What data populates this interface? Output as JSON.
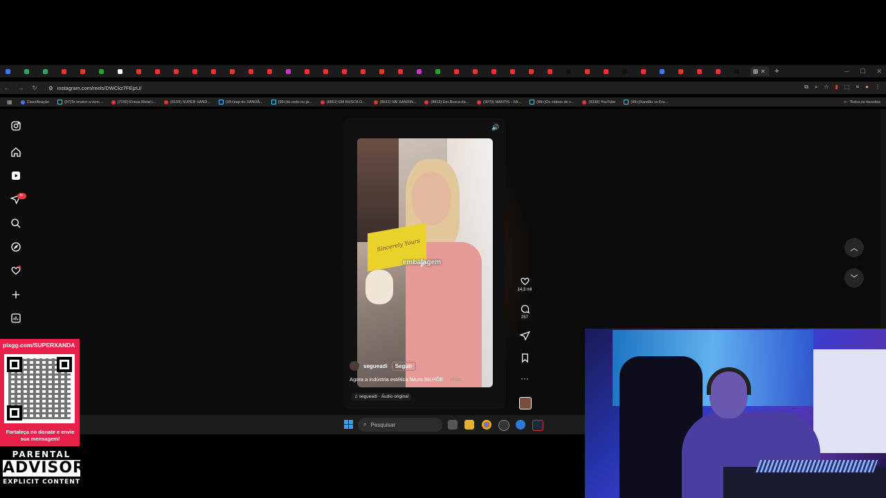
{
  "browser": {
    "url": "instagram.com/reels/DWCkz7FEjzU/",
    "bookmarks": [
      {
        "label": "Classificação",
        "icon": "globe-icon"
      },
      {
        "label": "(97)Te ensino a venc...",
        "icon": "tiktok-icon"
      },
      {
        "label": "(7292) Eneas Metal |...",
        "icon": "youtube-icon"
      },
      {
        "label": "(8159) SUPER XAND...",
        "icon": "youtube-icon"
      },
      {
        "label": "(99+)rap do XANDÃ...",
        "icon": "tiktok-icon"
      },
      {
        "label": "(99+)tá cedo ou já...",
        "icon": "tiktok-icon"
      },
      {
        "label": "(8851) EM BUSCA D...",
        "icon": "youtube-icon"
      },
      {
        "label": "(8912) VAI XANDIN...",
        "icon": "youtube-icon"
      },
      {
        "label": "(8912) Em Busca da...",
        "icon": "youtube-icon"
      },
      {
        "label": "(9078) MANTIS - XA...",
        "icon": "youtube-icon"
      },
      {
        "label": "(99+)Os vídeos de c...",
        "icon": "tiktok-icon"
      },
      {
        "label": "(9338) YouTube",
        "icon": "youtube-icon"
      },
      {
        "label": "(99+)Xandão vs Fra...",
        "icon": "tiktok-icon"
      }
    ],
    "all_favorites": "Todos os favoritos"
  },
  "instagram": {
    "notification_badge": "9+",
    "reel": {
      "overlay_text": "embalagem",
      "product_text": "Sincerely Yours",
      "author": "segueadi",
      "follow_label": "Seguir",
      "caption": "Agora a indústria estética fatura BILHÕE",
      "more_label": "... mais",
      "audio": "segueadi · Áudio original"
    },
    "actions": {
      "likes": "14,3 mil",
      "comments": "257"
    }
  },
  "taskbar": {
    "search_placeholder": "Pesquisar"
  },
  "overlays": {
    "pix_url": "pixgg.com/SUPERXANDA",
    "pix_message": "Fortaleça no donate e envie sua mensagem!",
    "advisory_line1": "PARENTAL",
    "advisory_line2": "ADVISORY",
    "advisory_line3": "EXPLICIT CONTENT"
  }
}
